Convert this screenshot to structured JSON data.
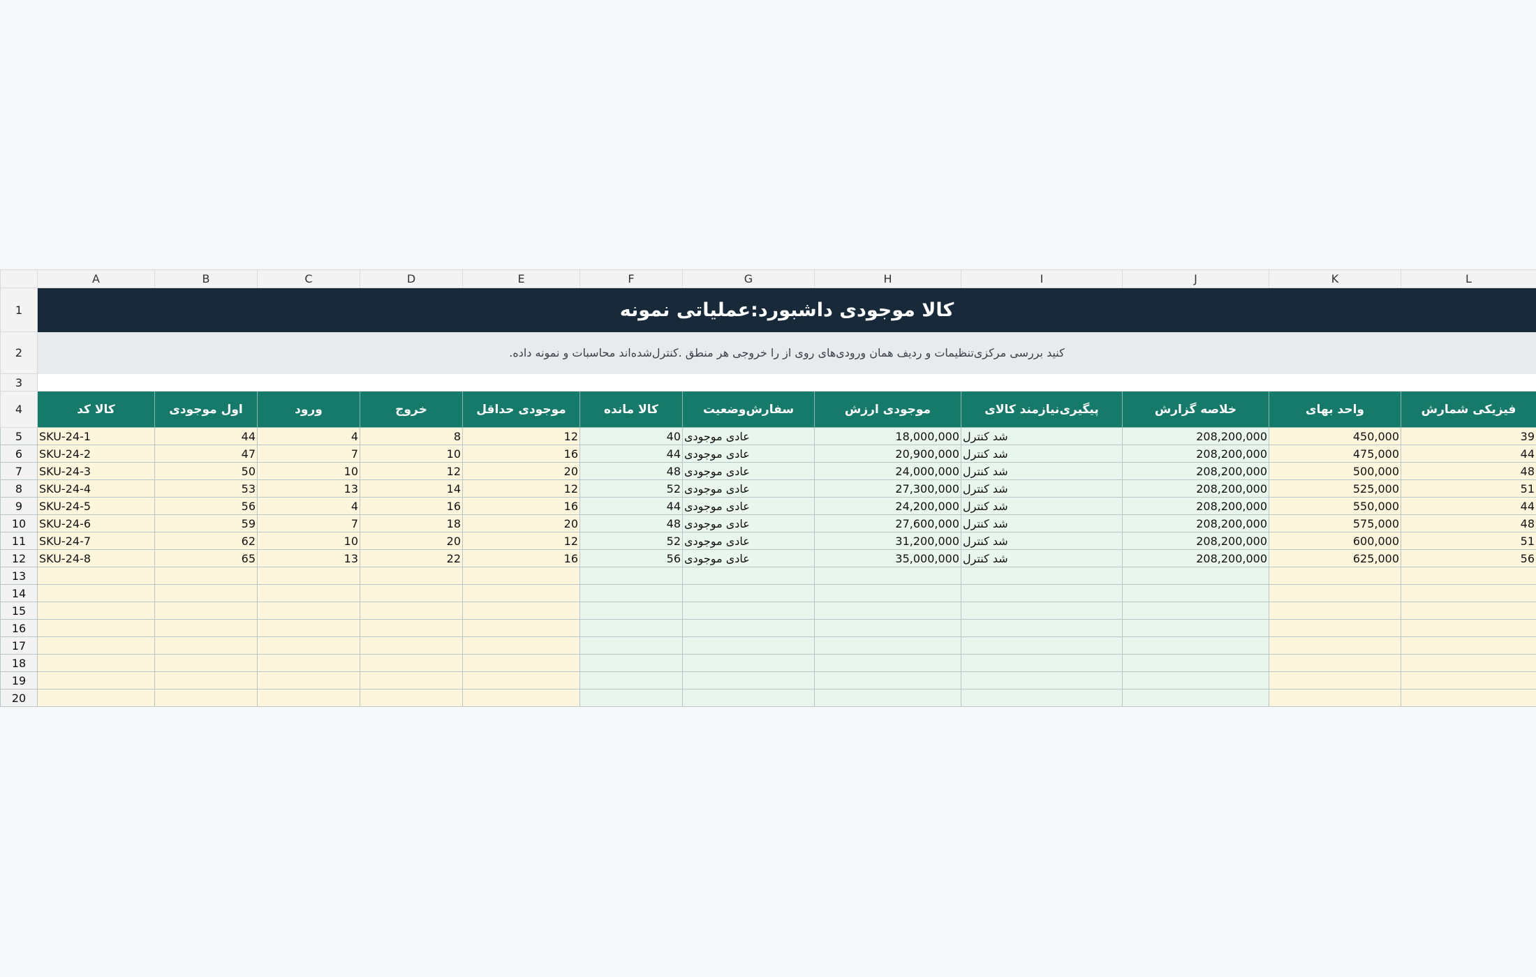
{
  "columns": [
    "A",
    "B",
    "C",
    "D",
    "E",
    "F",
    "G",
    "H",
    "I",
    "J",
    "K",
    "L"
  ],
  "title": "کالا موجودی داشبورد:عملیاتی نمونه",
  "subtitle": ".کنید بررسی مرکزی‌تنظیمات و ردیف همان ورودی‌های روی از را خروجی هر منطق .کنترل‌شده‌اند محاسبات و نمونه داده",
  "headers": [
    "کالا کد",
    "اول موجودی",
    "ورود",
    "خروج",
    "موجودی حداقل",
    "کالا مانده",
    "سفارش‌وضعیت",
    "موجودی ارزش",
    "پیگیری‌نیازمند کالای",
    "خلاصه گزارش",
    "واحد بهای",
    "فیزیکی شمارش"
  ],
  "row_numbers": [
    "1",
    "2",
    "3",
    "4",
    "5",
    "6",
    "7",
    "8",
    "9",
    "10",
    "11",
    "12",
    "13",
    "14",
    "15",
    "16",
    "17",
    "18",
    "19",
    "20"
  ],
  "rows": [
    [
      "SKU-24-1",
      "44",
      "4",
      "8",
      "12",
      "40",
      "عادی موجودی",
      "18,000,000",
      "شد کنترل",
      "208,200,000",
      "450,000",
      "39"
    ],
    [
      "SKU-24-2",
      "47",
      "7",
      "10",
      "16",
      "44",
      "عادی موجودی",
      "20,900,000",
      "شد کنترل",
      "208,200,000",
      "475,000",
      "44"
    ],
    [
      "SKU-24-3",
      "50",
      "10",
      "12",
      "20",
      "48",
      "عادی موجودی",
      "24,000,000",
      "شد کنترل",
      "208,200,000",
      "500,000",
      "48"
    ],
    [
      "SKU-24-4",
      "53",
      "13",
      "14",
      "12",
      "52",
      "عادی موجودی",
      "27,300,000",
      "شد کنترل",
      "208,200,000",
      "525,000",
      "51"
    ],
    [
      "SKU-24-5",
      "56",
      "4",
      "16",
      "16",
      "44",
      "عادی موجودی",
      "24,200,000",
      "شد کنترل",
      "208,200,000",
      "550,000",
      "44"
    ],
    [
      "SKU-24-6",
      "59",
      "7",
      "18",
      "20",
      "48",
      "عادی موجودی",
      "27,600,000",
      "شد کنترل",
      "208,200,000",
      "575,000",
      "48"
    ],
    [
      "SKU-24-7",
      "62",
      "10",
      "20",
      "12",
      "52",
      "عادی موجودی",
      "31,200,000",
      "شد کنترل",
      "208,200,000",
      "600,000",
      "51"
    ],
    [
      "SKU-24-8",
      "65",
      "13",
      "22",
      "16",
      "56",
      "عادی موجودی",
      "35,000,000",
      "شد کنترل",
      "208,200,000",
      "625,000",
      "56"
    ],
    [
      "",
      "",
      "",
      "",
      "",
      "",
      "",
      "",
      "",
      "",
      "",
      ""
    ],
    [
      "",
      "",
      "",
      "",
      "",
      "",
      "",
      "",
      "",
      "",
      "",
      ""
    ],
    [
      "",
      "",
      "",
      "",
      "",
      "",
      "",
      "",
      "",
      "",
      "",
      ""
    ],
    [
      "",
      "",
      "",
      "",
      "",
      "",
      "",
      "",
      "",
      "",
      "",
      ""
    ],
    [
      "",
      "",
      "",
      "",
      "",
      "",
      "",
      "",
      "",
      "",
      "",
      ""
    ],
    [
      "",
      "",
      "",
      "",
      "",
      "",
      "",
      "",
      "",
      "",
      "",
      ""
    ],
    [
      "",
      "",
      "",
      "",
      "",
      "",
      "",
      "",
      "",
      "",
      "",
      ""
    ],
    [
      "",
      "",
      "",
      "",
      "",
      "",
      "",
      "",
      "",
      "",
      "",
      ""
    ]
  ],
  "colors": {
    "title_bg": "#182a3a",
    "subtitle_bg": "#e7ebee",
    "header_bg": "#157a69",
    "input_cell_bg": "#fef6dc",
    "formula_cell_bg": "#e9f6ee"
  }
}
